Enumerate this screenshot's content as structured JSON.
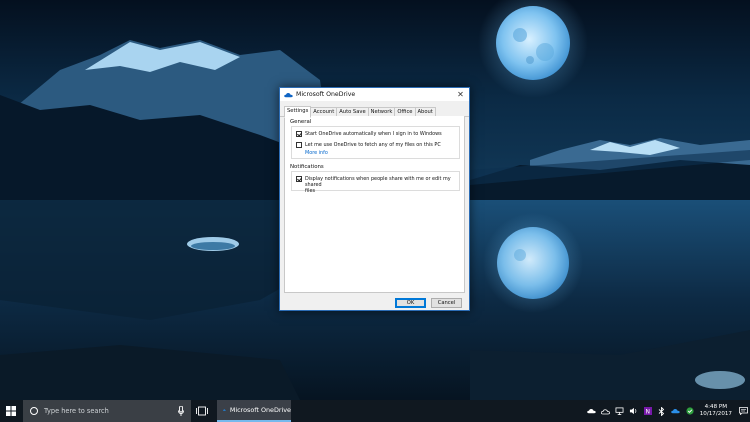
{
  "dialog": {
    "title": "Microsoft OneDrive",
    "tabs": [
      "Settings",
      "Account",
      "Auto Save",
      "Network",
      "Office",
      "About"
    ],
    "general": {
      "label": "General",
      "start_auto": {
        "label": "Start OneDrive automatically when I sign in to Windows",
        "checked": true
      },
      "fetch_files": {
        "label": "Let me use OneDrive to fetch any of my files on this PC",
        "checked": false
      },
      "more_info": "More info"
    },
    "notifications": {
      "label": "Notifications",
      "share_notify": {
        "label_line1": "Display notifications when people share with me or edit my shared",
        "label_line2": "files",
        "checked": true
      }
    },
    "ok_label": "OK",
    "cancel_label": "Cancel"
  },
  "taskbar": {
    "search_placeholder": "Type here to search",
    "app_label": "Microsoft OneDrive",
    "time": "4:48 PM",
    "date": "10/17/2017"
  },
  "icons": {
    "start": "windows-logo-icon",
    "search": "search-circle-icon",
    "mic": "microphone-icon",
    "task_view": "task-view-icon",
    "onedrive": "onedrive-cloud-icon",
    "tray": [
      "onedrive-tray-icon",
      "weather-icon",
      "network-icon",
      "volume-icon",
      "onenote-icon",
      "bluetooth-icon",
      "onedrive-tray-icon-2",
      "security-icon"
    ],
    "notifications": "action-center-icon"
  },
  "colors": {
    "accent": "#0078d7",
    "link": "#0066cc",
    "taskbar": "#101820"
  }
}
